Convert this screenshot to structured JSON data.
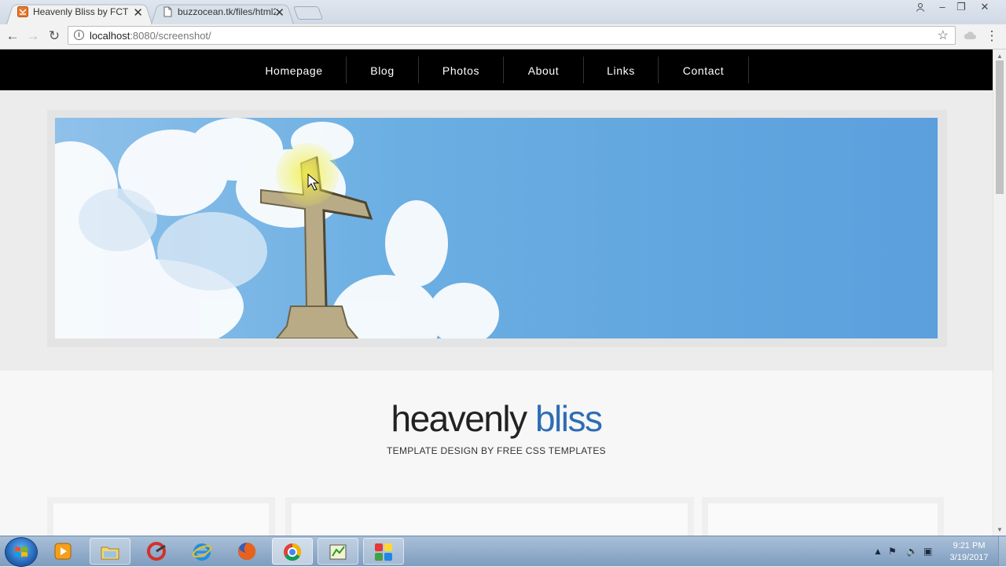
{
  "browser": {
    "tabs": [
      {
        "title": "Heavenly Bliss by FCT",
        "active": true
      },
      {
        "title": "buzzocean.tk/files/html2",
        "active": false
      }
    ],
    "url_host": "localhost",
    "url_path": ":8080/screenshot/"
  },
  "site": {
    "nav": [
      "Homepage",
      "Blog",
      "Photos",
      "About",
      "Links",
      "Contact"
    ],
    "brand_main": "heavenly",
    "brand_accent": "bliss",
    "tagline": "TEMPLATE DESIGN BY FREE CSS TEMPLATES",
    "accent_color": "#2e6db4"
  },
  "taskbar": {
    "time": "9:21 PM",
    "date": "3/19/2017"
  }
}
